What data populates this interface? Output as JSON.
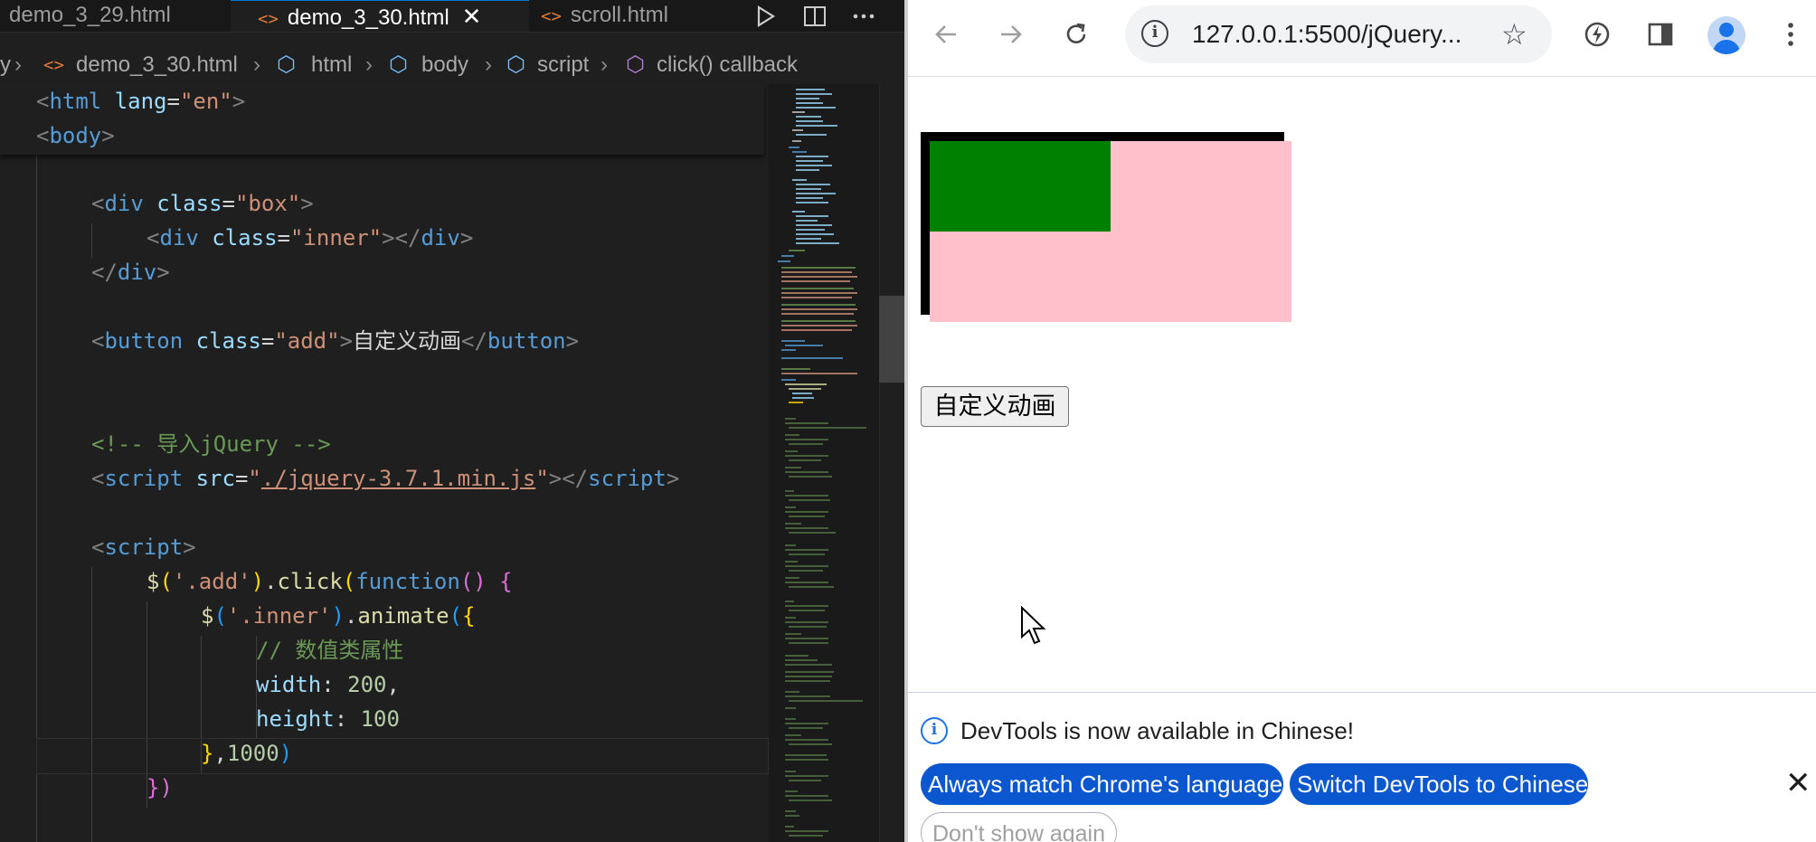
{
  "vscode": {
    "tabs": [
      {
        "label": "demo_3_29.html",
        "active": false
      },
      {
        "label": "demo_3_30.html",
        "active": true
      },
      {
        "label": "scroll.html",
        "active": false
      }
    ],
    "tab_close_glyph": "✕",
    "breadcrumb": [
      "demo_3_30.html",
      "html",
      "body",
      "script",
      "click() callback"
    ],
    "breadcrumb_lead": "y",
    "sticky_lines": {
      "line1": {
        "open": "<",
        "tag": "html",
        "attr": "lang",
        "eq": "=",
        "val": "\"en\"",
        "close": ">"
      },
      "line2": {
        "open": "<",
        "tag": "body",
        "close": ">"
      }
    },
    "code": {
      "div_box_tag": "div",
      "div_box_attr": "class",
      "div_box_val": "\"box\"",
      "div_inner_tag": "div",
      "div_inner_attr": "class",
      "div_inner_val": "\"inner\"",
      "div_close_tag": "div",
      "button_tag": "button",
      "button_attr": "class",
      "button_val": "\"add\"",
      "button_text": "自定义动画",
      "comment": "<!-- 导入jQuery -->",
      "script_tag": "script",
      "script_attr": "src",
      "script_src": "./jquery-3.7.1.min.js",
      "script2_tag": "script",
      "jq1": "$",
      "sel1": "'.add'",
      "click": "click",
      "function_kw": "function",
      "jq2": "$",
      "sel2": "'.inner'",
      "animate": "animate",
      "line_comment": "// 数值类属性",
      "width_key": "width",
      "width_val": "200",
      "height_key": "height",
      "height_val": "100",
      "duration": "1000"
    }
  },
  "chrome": {
    "url": "127.0.0.1:5500/jQuery...",
    "button_label": "自定义动画",
    "devtools": {
      "message": "DevTools is now available in Chinese!",
      "btn_match": "Always match Chrome's language",
      "btn_switch": "Switch DevTools to Chinese",
      "btn_dont_show": "Don't show again",
      "close": "✕"
    },
    "demo": {
      "box_color": "#ffc0cb",
      "inner_color": "#008000",
      "border_color": "#000000"
    }
  },
  "colors": {
    "vscode_bg": "#1f1f1f",
    "accent": "#0b57d0"
  }
}
